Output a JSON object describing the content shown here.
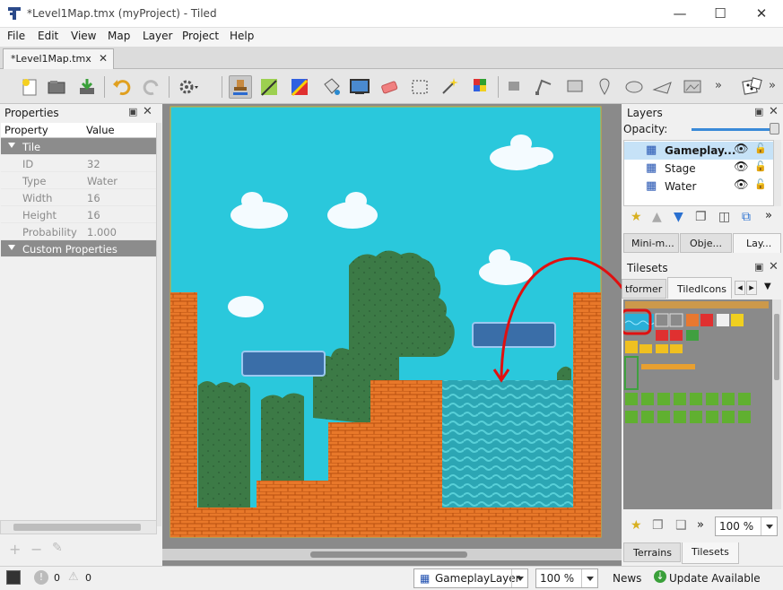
{
  "window": {
    "title": "*Level1Map.tmx (myProject) - Tiled"
  },
  "menu": [
    "File",
    "Edit",
    "View",
    "Map",
    "Layer",
    "Project",
    "Help"
  ],
  "document_tab": {
    "label": "*Level1Map.tmx"
  },
  "properties": {
    "title": "Properties",
    "header": {
      "property": "Property",
      "value": "Value"
    },
    "group_tile": "Tile",
    "rows": [
      {
        "key": "ID",
        "value": "32"
      },
      {
        "key": "Type",
        "value": "Water"
      },
      {
        "key": "Width",
        "value": "16"
      },
      {
        "key": "Height",
        "value": "16"
      },
      {
        "key": "Probability",
        "value": "1.000"
      }
    ],
    "group_custom": "Custom Properties"
  },
  "layers": {
    "title": "Layers",
    "opacity_label": "Opacity:",
    "opacity": 1.0,
    "items": [
      {
        "name": "Gameplay...",
        "selected": true
      },
      {
        "name": "Stage",
        "selected": false
      },
      {
        "name": "Water",
        "selected": false
      }
    ],
    "tabs": [
      "Mini-m...",
      "Obje...",
      "Lay..."
    ]
  },
  "tilesets": {
    "title": "Tilesets",
    "tabs": [
      "tformer",
      "TiledIcons"
    ],
    "zoom": "100 %",
    "bottom_tabs": [
      "Terrains",
      "Tilesets"
    ]
  },
  "status": {
    "errors": "0",
    "warnings": "0",
    "layer_select": "GameplayLayer",
    "zoom": "100 %",
    "news": "News",
    "update": "Update Available"
  },
  "colors": {
    "sky": "#2ac8dc",
    "brick": "#e8782a",
    "bush": "#3c7a46",
    "water": "#2ca6b4",
    "platform": "#3a6ea8",
    "selection": "#c6e2f7",
    "annotation": "#e01010"
  }
}
